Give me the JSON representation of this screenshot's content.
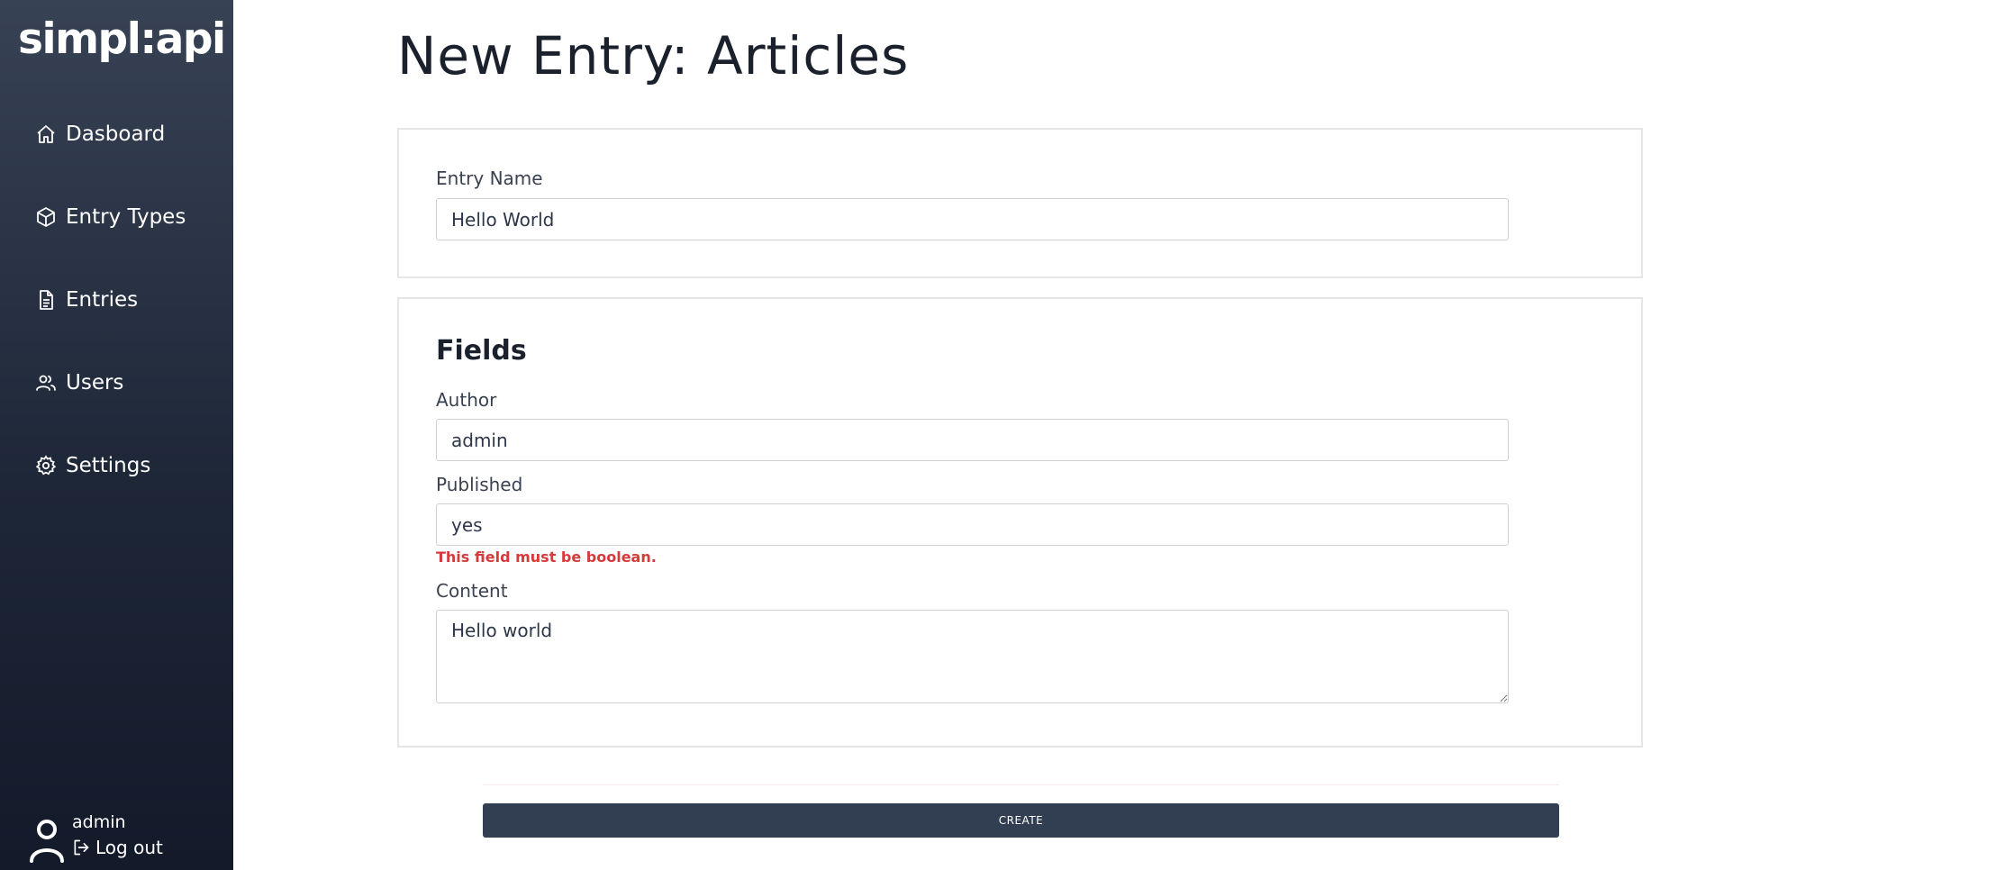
{
  "sidebar": {
    "brand": "simpl:api",
    "items": [
      {
        "label": "Dasboard",
        "icon": "home-icon"
      },
      {
        "label": "Entry Types",
        "icon": "cube-icon"
      },
      {
        "label": "Entries",
        "icon": "document-icon"
      },
      {
        "label": "Users",
        "icon": "users-icon"
      },
      {
        "label": "Settings",
        "icon": "gear-icon"
      }
    ],
    "user": {
      "name": "admin",
      "logout_label": "Log out"
    }
  },
  "main": {
    "title": "New Entry: Articles",
    "entry": {
      "name_label": "Entry Name",
      "name_value": "Hello World"
    },
    "fields": {
      "heading": "Fields",
      "author_label": "Author",
      "author_value": "admin",
      "published_label": "Published",
      "published_value": "yes",
      "published_error": "This field must be boolean.",
      "content_label": "Content",
      "content_value": "Hello world"
    },
    "create_label": "CREATE"
  },
  "colors": {
    "sidebar_top": "#374254",
    "sidebar_bottom": "#131a2a",
    "button": "#323f52",
    "error": "#d63a3a"
  }
}
